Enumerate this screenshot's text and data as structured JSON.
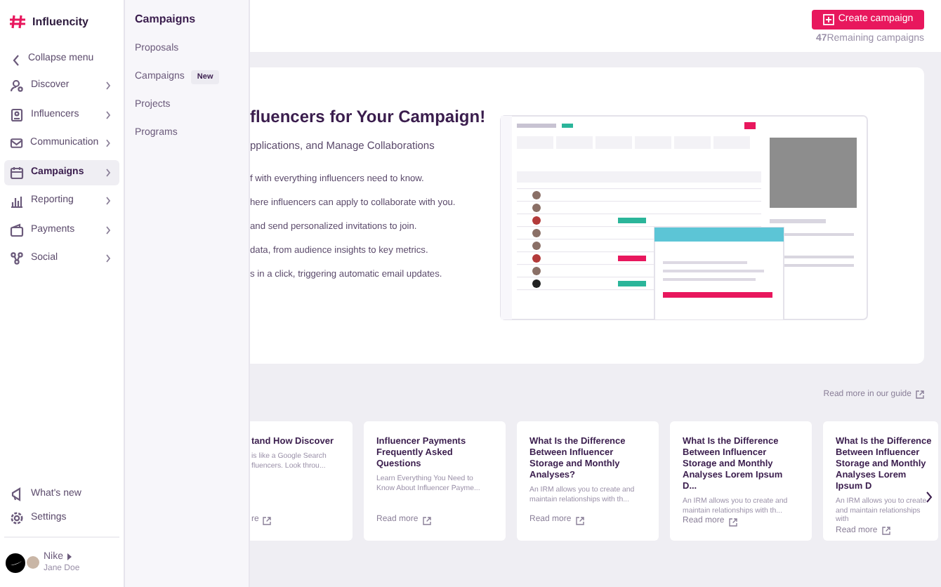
{
  "sidebar": {
    "logo": "Influencity",
    "collapse": "Collapse menu",
    "items": [
      {
        "label": "Discover",
        "selected": false
      },
      {
        "label": "Influencers",
        "selected": false
      },
      {
        "label": "Communication",
        "selected": false
      },
      {
        "label": "Campaigns",
        "selected": true
      },
      {
        "label": "Reporting",
        "selected": false
      },
      {
        "label": "Payments",
        "selected": false
      },
      {
        "label": "Social",
        "selected": false
      }
    ],
    "footer_items": [
      "What's new",
      "Settings"
    ],
    "account": {
      "organization": "Nike",
      "user": "Jane Doe"
    }
  },
  "submenu": {
    "title": "Campaigns",
    "items": [
      {
        "label": "Proposals"
      },
      {
        "label": "Campaigns",
        "badge": "New"
      },
      {
        "label": "Projects"
      },
      {
        "label": "Programs"
      }
    ]
  },
  "header": {
    "button": "Create campaign",
    "remaining": "**47**Remaining campaigns"
  },
  "hero": {
    "title": "fluencers for Your Campaign!",
    "subtitle": "pplications, and Manage Collaborations",
    "bullets": [
      "f with everything influencers need to know.",
      "here influencers can apply to collaborate with you.",
      "and send personalized invitations to join.",
      "data, from audience insights to key metrics.",
      "s in a click, triggering automatic email updates."
    ]
  },
  "guide_link": "Read more in our guide",
  "articles": [
    {
      "title": "tand How Discover",
      "description": "is like a Google Search fluencers. Look throu...",
      "link": "re"
    },
    {
      "title": "Influencer Payments Frequently Asked Questions",
      "description": "Learn Everything You Need to Know About Influencer Payme...",
      "link": "Read more"
    },
    {
      "title": "What Is the Difference Between Influencer Storage and Monthly Analyses?",
      "description": "An IRM allows you to create and maintain relationships with th...",
      "link": "Read more"
    },
    {
      "title": "What Is the Difference Between Influencer Storage and Monthly Analyses Lorem Ipsum D...",
      "description": "An IRM allows you to create and maintain relationships with th...",
      "link": "Read more"
    },
    {
      "title": "What Is the Difference Between Influencer Storage and Monthly Analyses Lorem Ipsum D",
      "description": "An IRM allows you to create and maintain relationships with",
      "link": "Read more"
    }
  ]
}
